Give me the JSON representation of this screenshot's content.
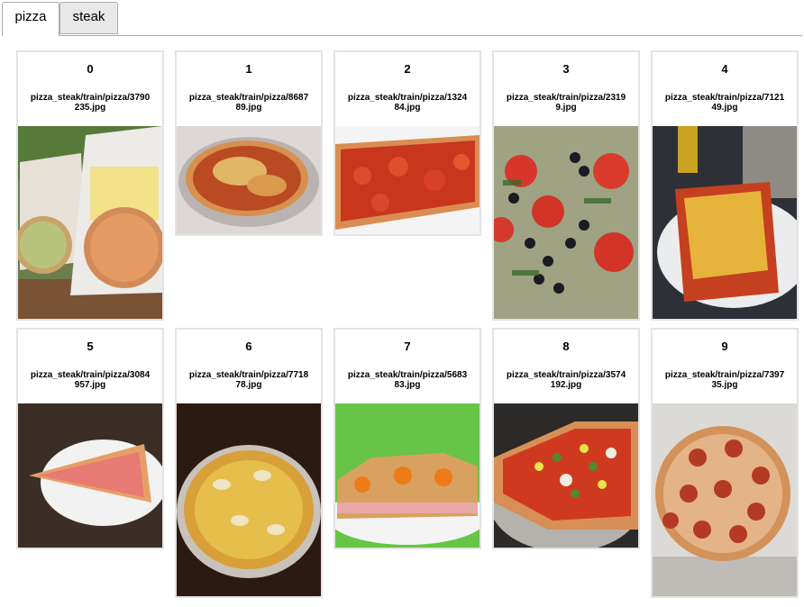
{
  "tabs": [
    {
      "label": "pizza",
      "active": true
    },
    {
      "label": "steak",
      "active": false
    }
  ],
  "cards": [
    {
      "index": "0",
      "path": "pizza_steak/train/pizza/3790\n235.jpg"
    },
    {
      "index": "1",
      "path": "pizza_steak/train/pizza/8687\n89.jpg"
    },
    {
      "index": "2",
      "path": "pizza_steak/train/pizza/1324\n84.jpg"
    },
    {
      "index": "3",
      "path": "pizza_steak/train/pizza/2319\n9.jpg"
    },
    {
      "index": "4",
      "path": "pizza_steak/train/pizza/7121\n49.jpg"
    },
    {
      "index": "5",
      "path": "pizza_steak/train/pizza/3084\n957.jpg"
    },
    {
      "index": "6",
      "path": "pizza_steak/train/pizza/7718\n78.jpg"
    },
    {
      "index": "7",
      "path": "pizza_steak/train/pizza/5683\n83.jpg"
    },
    {
      "index": "8",
      "path": "pizza_steak/train/pizza/3574\n192.jpg"
    },
    {
      "index": "9",
      "path": "pizza_steak/train/pizza/7397\n35.jpg"
    }
  ],
  "colors": {
    "tab_border": "#aaaaaa",
    "card_border": "#e3e3e3",
    "inactive_tab_bg": "#e8e8e8"
  }
}
